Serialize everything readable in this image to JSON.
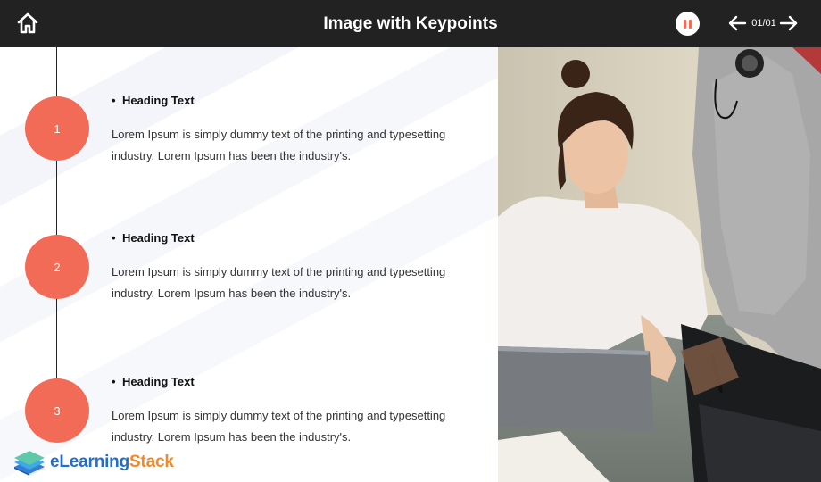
{
  "header": {
    "title": "Image with Keypoints",
    "page_indicator": "01/01",
    "icons": {
      "home": "home-icon",
      "pause": "pause-icon",
      "prev": "arrow-left-icon",
      "next": "arrow-right-icon"
    }
  },
  "keypoints": [
    {
      "number": "1",
      "heading": "Heading Text",
      "text": "Lorem Ipsum is simply dummy text of the printing and typesetting industry. Lorem Ipsum has been the industry's."
    },
    {
      "number": "2",
      "heading": "Heading Text",
      "text": "Lorem Ipsum is simply dummy text of the printing and typesetting industry. Lorem Ipsum has been the industry's."
    },
    {
      "number": "3",
      "heading": "Heading Text",
      "text": "Lorem Ipsum is simply dummy text of the printing and typesetting industry. Lorem Ipsum has been the industry's."
    }
  ],
  "logo": {
    "part1": "eLearning",
    "part2": "Stack"
  },
  "colors": {
    "header_bg": "#222222",
    "accent": "#f26b57",
    "logo_blue": "#1e6fd0",
    "logo_orange": "#f08a2c"
  }
}
